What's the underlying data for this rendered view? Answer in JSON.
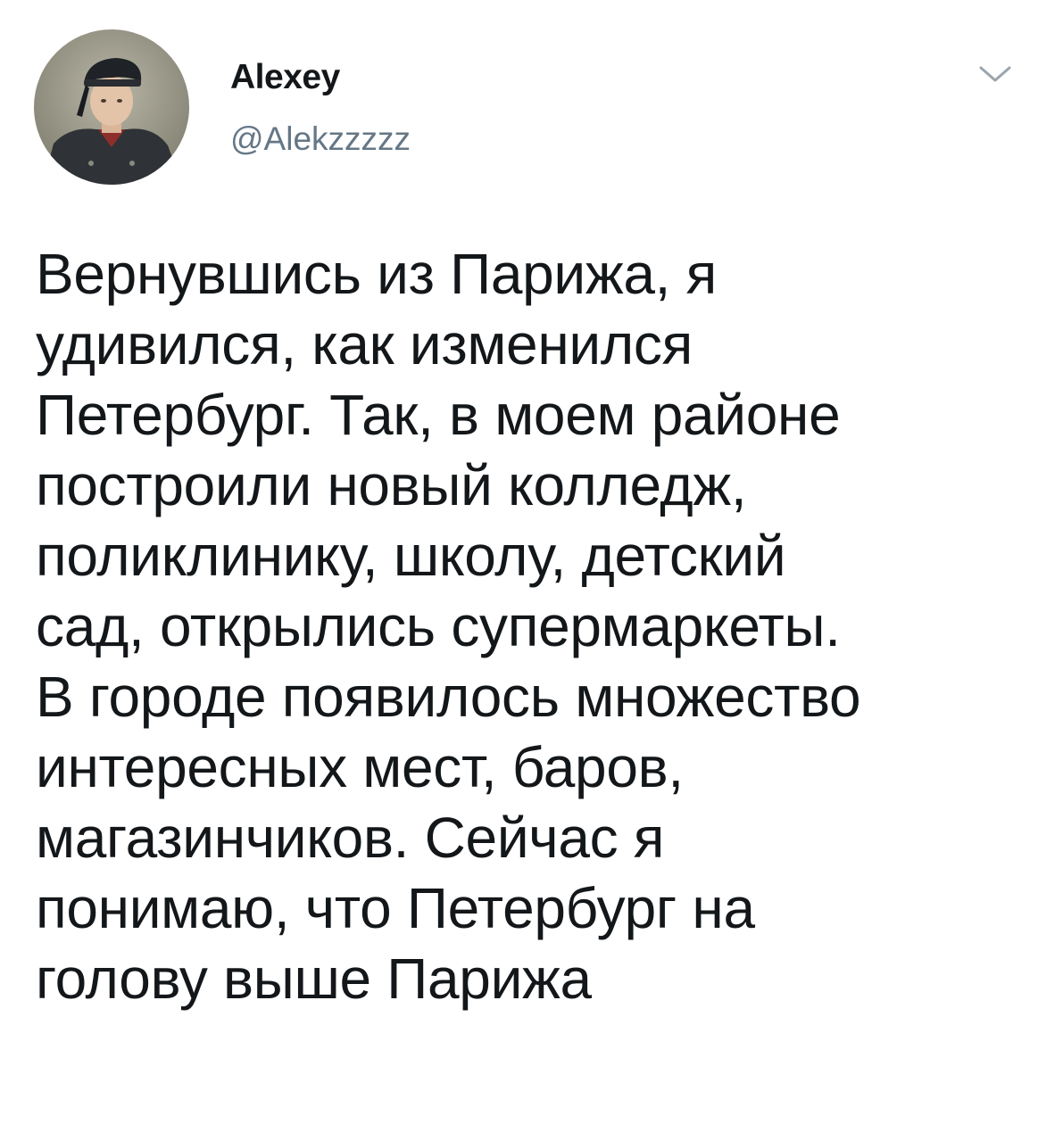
{
  "author": {
    "display_name": "Alexey",
    "handle": "@Alekzzzzz",
    "avatar_icon": "user-avatar-photo"
  },
  "menu": {
    "icon": "chevron-down-icon",
    "color": "#9aa5ae"
  },
  "tweet": {
    "text": "Вернувшись из Парижа, я\nудивился, как изменился\nПетербург. Так, в моем районе\nпостроили новый колледж,\nполиклинику, школу, детский\nсад, открылись супермаркеты.\nВ городе появилось множество\nинтересных мест, баров,\nмагазинчиков. Сейчас я\nпонимаю, что Петербург на\nголову выше Парижа"
  },
  "colors": {
    "text": "#14171a",
    "secondary_text": "#657786",
    "background": "#ffffff"
  }
}
